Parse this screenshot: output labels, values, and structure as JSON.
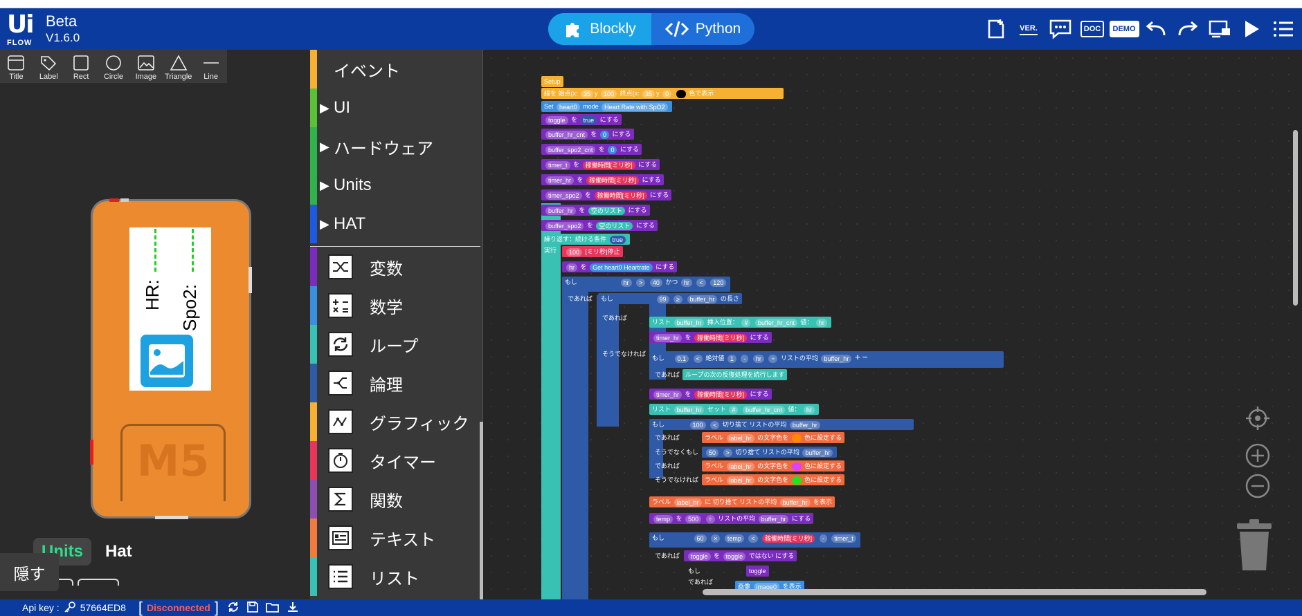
{
  "header": {
    "logo_top": "Ui",
    "logo_bottom": "FLOW",
    "beta": "Beta",
    "version": "V1.6.0",
    "modes": [
      {
        "label": "Blockly",
        "icon": "puzzle-icon",
        "active": true
      },
      {
        "label": "Python",
        "icon": "code-icon",
        "active": false
      }
    ],
    "tools": {
      "ver": "VER.",
      "doc": "DOC",
      "demo": "DEMO"
    }
  },
  "shapes": [
    "Title",
    "Label",
    "Rect",
    "Circle",
    "Image",
    "Triangle",
    "Line"
  ],
  "device": {
    "hr_label": "HR:",
    "spo2_label": "Spo2:",
    "brand": "M5"
  },
  "left_tabs": {
    "units": "Units",
    "hat": "Hat"
  },
  "hide_button": "隠す",
  "categories": [
    {
      "label": "イベント",
      "color": "#f6b032",
      "arrow": ""
    },
    {
      "label": "UI",
      "color": "#5bc236",
      "arrow": "▶"
    },
    {
      "label": "ハードウェア",
      "color": "#2fb34a",
      "arrow": "▶"
    },
    {
      "label": "Units",
      "color": "#2fb34a",
      "arrow": "▶"
    },
    {
      "label": "HAT",
      "color": "#1e5adf",
      "arrow": "▶"
    }
  ],
  "tool_categories": [
    {
      "label": "変数",
      "color": "#7b2cbe",
      "icon": "shuffle-icon"
    },
    {
      "label": "数学",
      "color": "#3c8fde",
      "icon": "calculator-icon"
    },
    {
      "label": "ループ",
      "color": "#39c1b4",
      "icon": "loop-icon"
    },
    {
      "label": "論理",
      "color": "#2e5aa8",
      "icon": "logic-icon"
    },
    {
      "label": "グラフィック",
      "color": "#f6b032",
      "icon": "graph-icon"
    },
    {
      "label": "タイマー",
      "color": "#e9355a",
      "icon": "timer-icon"
    },
    {
      "label": "関数",
      "color": "#8c4eb0",
      "icon": "sigma-icon"
    },
    {
      "label": "テキスト",
      "color": "#f07a40",
      "icon": "text-icon"
    },
    {
      "label": "リスト",
      "color": "#39c1b4",
      "icon": "list-icon"
    }
  ],
  "blocks": {
    "setup": "Setup",
    "line1": {
      "pre": "線を 始点(x:",
      "x1": "35",
      "y1": "100",
      "mid": "終点(x:",
      "x2": "35",
      "y2": "0",
      "post": "色で表示"
    },
    "set_heart": {
      "pre": "Set",
      "var": "heart0",
      "mode": "mode",
      "val": "Heart Rate with SpO2"
    },
    "vars": [
      {
        "name": "toggle",
        "val": "true"
      },
      {
        "name": "buffer_hr_cnt",
        "val": "0"
      },
      {
        "name": "buffer_spo2_cnt",
        "val": "0"
      },
      {
        "name": "timer_t",
        "val": "稼働時間[ミリ秒]"
      },
      {
        "name": "timer_hr",
        "val": "稼働時間[ミリ秒]"
      },
      {
        "name": "timer_spo2",
        "val": "稼働時間[ミリ秒]"
      },
      {
        "name": "buffer_hr",
        "val": "空のリスト"
      },
      {
        "name": "buffer_spo2",
        "val": "空のリスト"
      }
    ],
    "set_suffix": "を",
    "set_end": "にする",
    "repeat": "繰り返す：続ける条件",
    "repeat_val": "true",
    "exec": "実行",
    "wait": {
      "val": "100",
      "text": "[ミリ秒]停止"
    },
    "hr_get": {
      "var": "hr",
      "get": "Get",
      "obj": "heart0",
      "prop": "Heartrate"
    },
    "if": "もし",
    "then": "であれば",
    "else": "そうでなければ",
    "elseif": "そうでなくもし",
    "cond1": {
      "a": "hr",
      "op1": ">",
      "v1": "40",
      "and": "かつ",
      "b": "hr",
      "op2": "<",
      "v2": "120"
    },
    "cond2": {
      "v": "99",
      "op": "≥",
      "list": "buffer_hr",
      "len": "の長さ"
    },
    "insert": {
      "list": "リスト",
      "var": "buffer_hr",
      "act": "挿入位置：",
      "pos": "#",
      "idx": "buffer_hr_cnt",
      "val": "値：",
      "item": "hr"
    },
    "timer_set": {
      "var": "timer_hr",
      "val": "稼働時間[ミリ秒]"
    },
    "cond3": {
      "v": "0.1",
      "op": "<",
      "fn": "絶対値",
      "one": "1",
      "minus": "-",
      "hr": "hr",
      "div": "÷",
      "avg": "リストの平均",
      "list": "buffer_hr"
    },
    "continue": "ループの次の反復処理を続行します",
    "set_list": {
      "list": "リスト",
      "var": "buffer_hr",
      "act": "セット",
      "pos": "#",
      "idx": "buffer_hr_cnt",
      "val": "値：",
      "item": "hr"
    },
    "cond4": {
      "v": "100",
      "op": "<",
      "fn": "切り捨て",
      "avg": "リストの平均",
      "list": "buffer_hr"
    },
    "label_set": {
      "pre": "ラベル",
      "lbl": "label_hr",
      "mid": "の文字色を",
      "post": "色に設定する"
    },
    "cond5": {
      "v": "50",
      "op": ">",
      "fn": "切り捨て",
      "avg": "リストの平均",
      "list": "buffer_hr"
    },
    "label_show": {
      "pre": "ラベル",
      "lbl": "label_hr",
      "ni": "に",
      "fn": "切り捨て",
      "avg": "リストの平均",
      "list": "buffer_hr",
      "post": "を表示"
    },
    "temp": {
      "var": "temp",
      "v": "500",
      "op": "÷",
      "avg": "リストの平均",
      "list": "buffer_hr"
    },
    "cond6": {
      "v": "60",
      "op": "×",
      "var": "temp",
      "lt": "<",
      "t": "稼働時間[ミリ秒]",
      "minus": "-",
      "tt": "timer_t"
    },
    "toggle_not": {
      "var": "toggle",
      "arg": "toggle",
      "not": "ではない"
    },
    "toggle_if": "toggle",
    "image": {
      "pre": "画像",
      "var": "image0",
      "post": "を表示"
    }
  },
  "status": {
    "api_label": "Api key :",
    "api_key": "57664ED8",
    "bracket_open": "[",
    "connection": "Disconnected",
    "bracket_close": "]"
  },
  "colors": {
    "header": "#0b3b9e",
    "mode_active": "#1aa3e8",
    "device": "#ec8a2f",
    "units_tab": "#2ddc8a",
    "disconnected": "#ff5a5a"
  }
}
